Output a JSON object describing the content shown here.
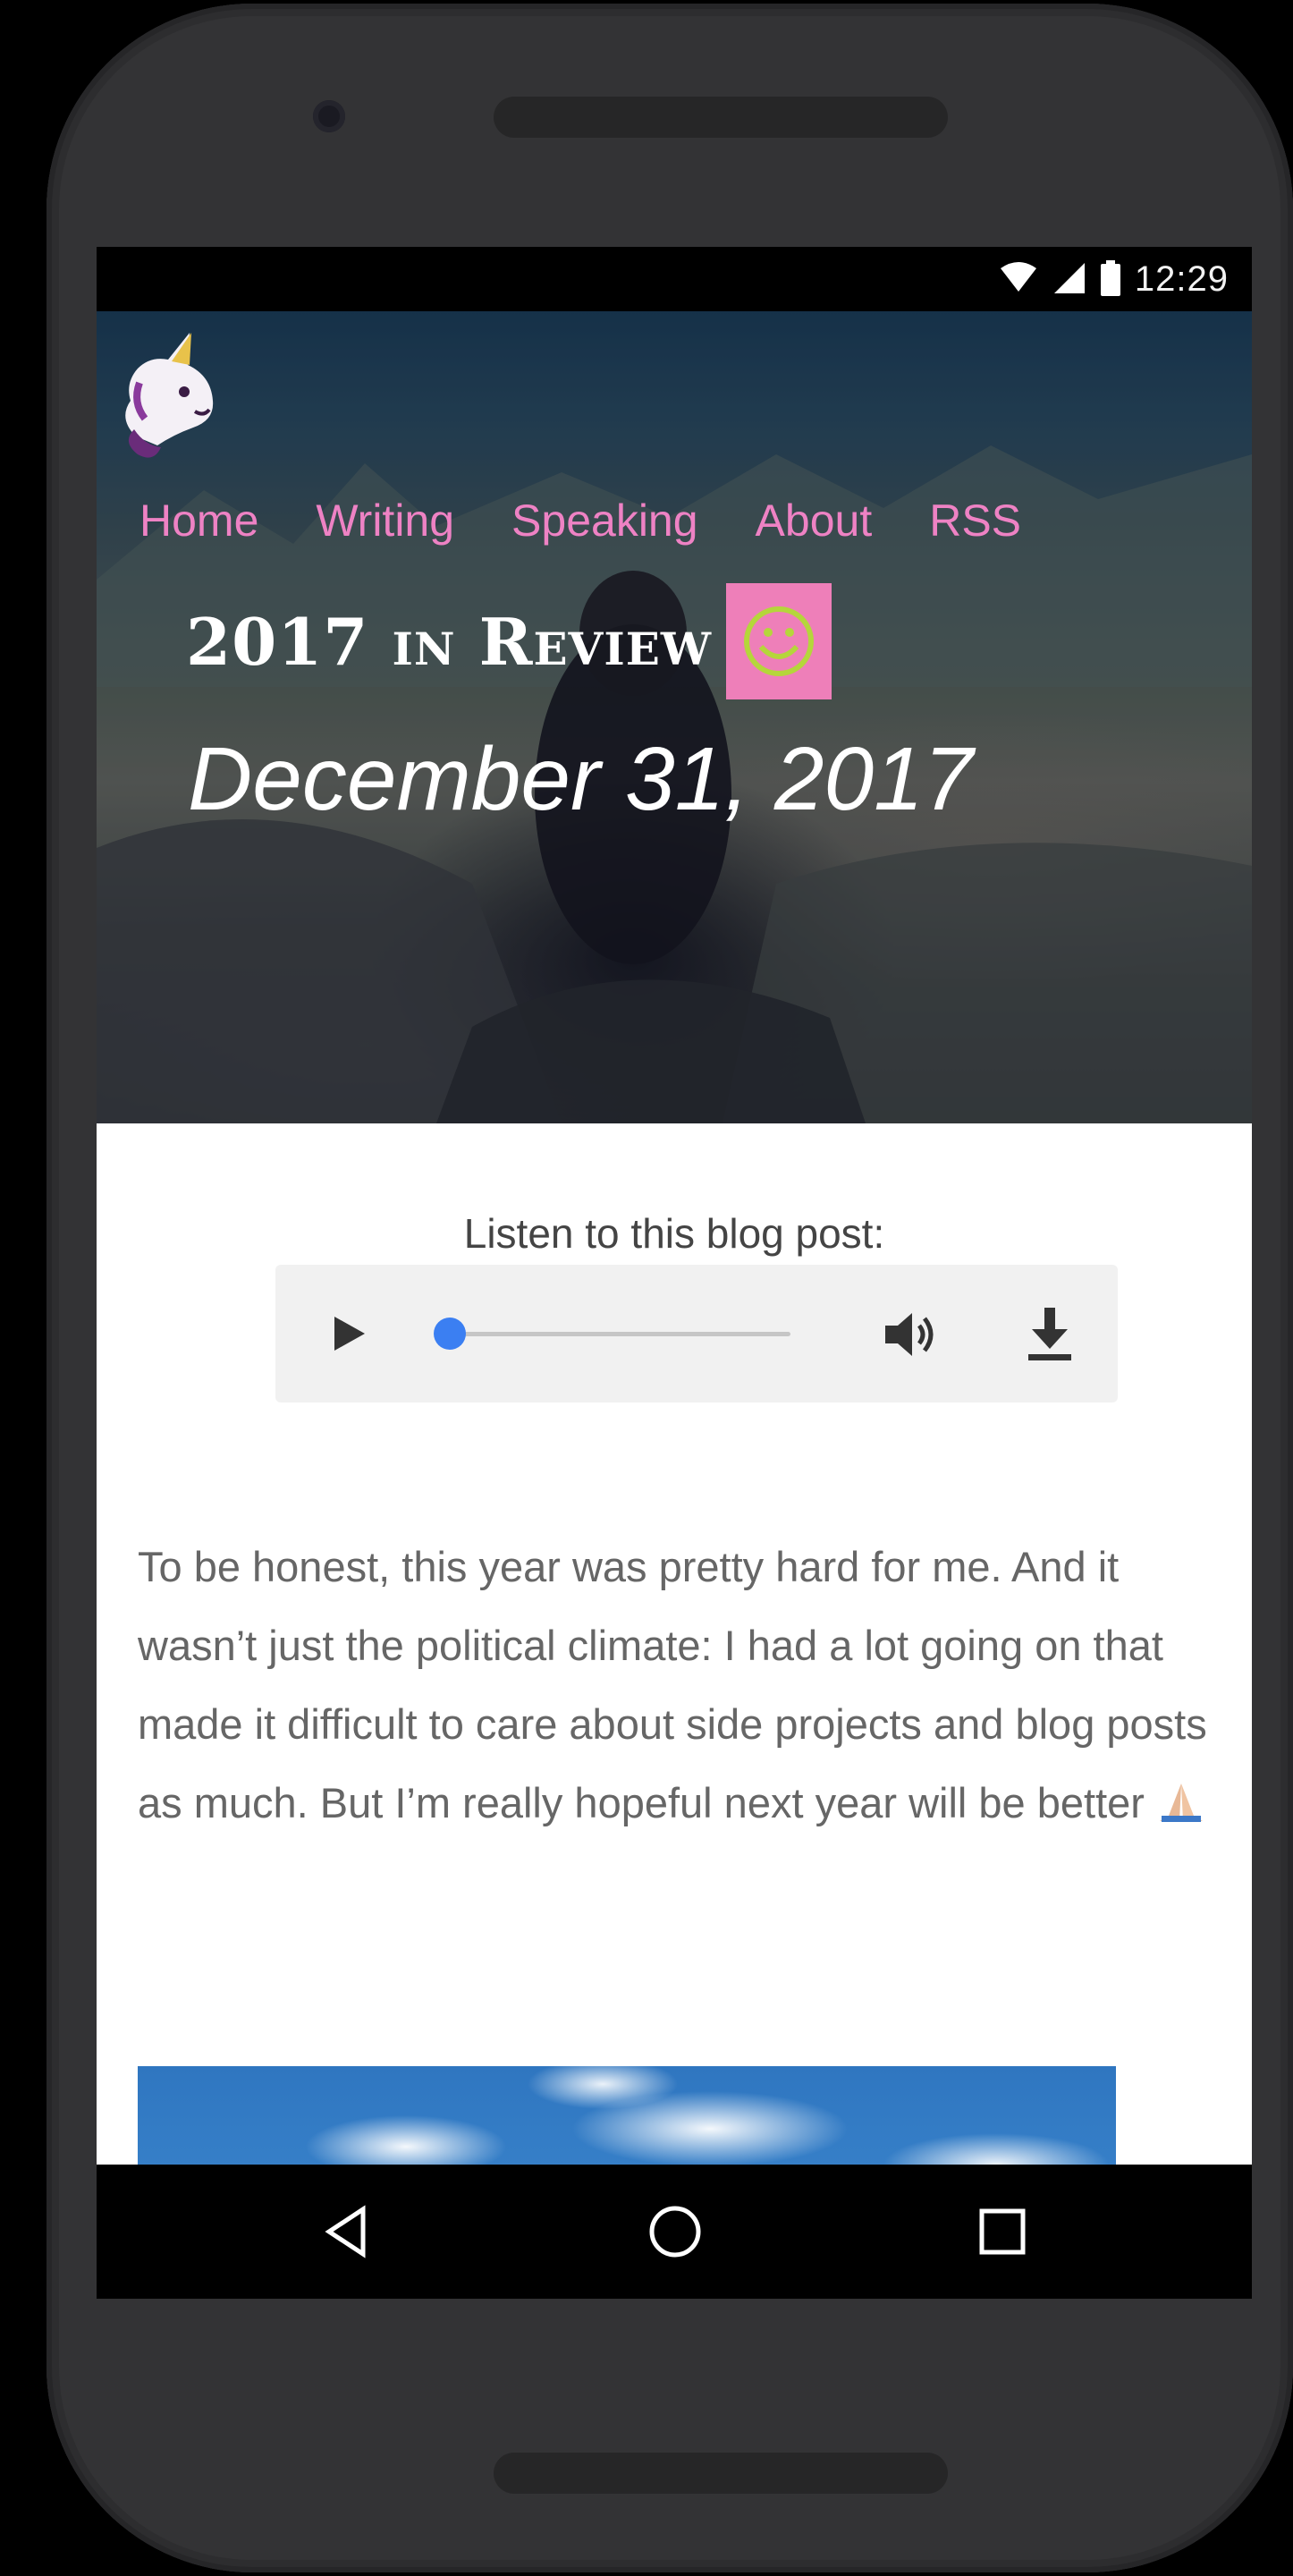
{
  "status_bar": {
    "time": "12:29"
  },
  "site": {
    "nav": [
      "Home",
      "Writing",
      "Speaking",
      "About",
      "RSS"
    ],
    "nav_color": "#ee82c4"
  },
  "post": {
    "title": "2017 in Review",
    "emoji": "smiley-icon",
    "date": "December 31, 2017",
    "audio": {
      "prompt": "Listen to this blog post:",
      "progress": 0
    },
    "body": "To be honest, this year was pretty hard for me. And it wasn’t just the political climate: I had a lot going on that made it difficult to care about side projects and blog posts as much. But I’m really hopeful next year will be better"
  },
  "colors": {
    "accent_pink": "#ee7fb9",
    "slider_blue": "#3b7ff2",
    "smiley_green": "#b5d63b"
  }
}
